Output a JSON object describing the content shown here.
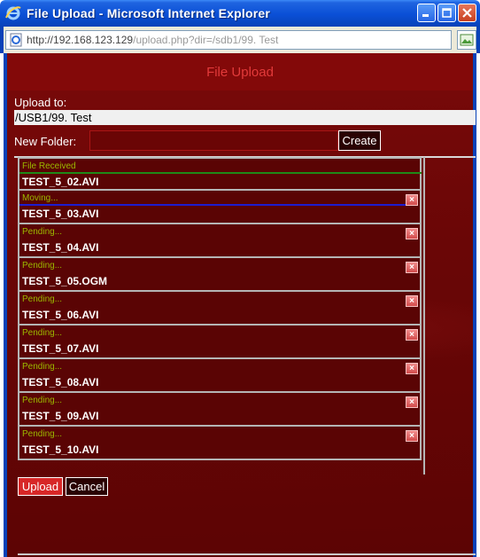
{
  "window": {
    "title": "File Upload - Microsoft Internet Explorer",
    "icon": "ie-icon"
  },
  "address": {
    "url_prefix": "http://192.168.123.129",
    "url_rest": "/upload.php?dir=/sdb1/99. Test"
  },
  "page": {
    "header": "File Upload",
    "upload_to_label": "Upload to:",
    "upload_to_value": "/USB1/99. Test",
    "new_folder_label": "New Folder:",
    "new_folder_value": "",
    "create_label": "Create",
    "upload_label": "Upload",
    "cancel_label": "Cancel"
  },
  "files": [
    {
      "status": "File Received",
      "name": "TEST_5_02.AVI",
      "progress": "done"
    },
    {
      "status": "Moving...",
      "name": "TEST_5_03.AVI",
      "progress": "moving"
    },
    {
      "status": "Pending...",
      "name": "TEST_5_04.AVI",
      "progress": "pending"
    },
    {
      "status": "Pending...",
      "name": "TEST_5_05.OGM",
      "progress": "pending"
    },
    {
      "status": "Pending...",
      "name": "TEST_5_06.AVI",
      "progress": "pending"
    },
    {
      "status": "Pending...",
      "name": "TEST_5_07.AVI",
      "progress": "pending"
    },
    {
      "status": "Pending...",
      "name": "TEST_5_08.AVI",
      "progress": "pending"
    },
    {
      "status": "Pending...",
      "name": "TEST_5_09.AVI",
      "progress": "pending"
    },
    {
      "status": "Pending...",
      "name": "TEST_5_10.AVI",
      "progress": "pending"
    }
  ],
  "colors": {
    "page_bg": "#6a0606",
    "header_text": "#e23a3a",
    "status_text": "#9bb800",
    "upload_button": "#d72727",
    "progress_done": "#1f8a17",
    "progress_moving": "#1d1dcf"
  }
}
